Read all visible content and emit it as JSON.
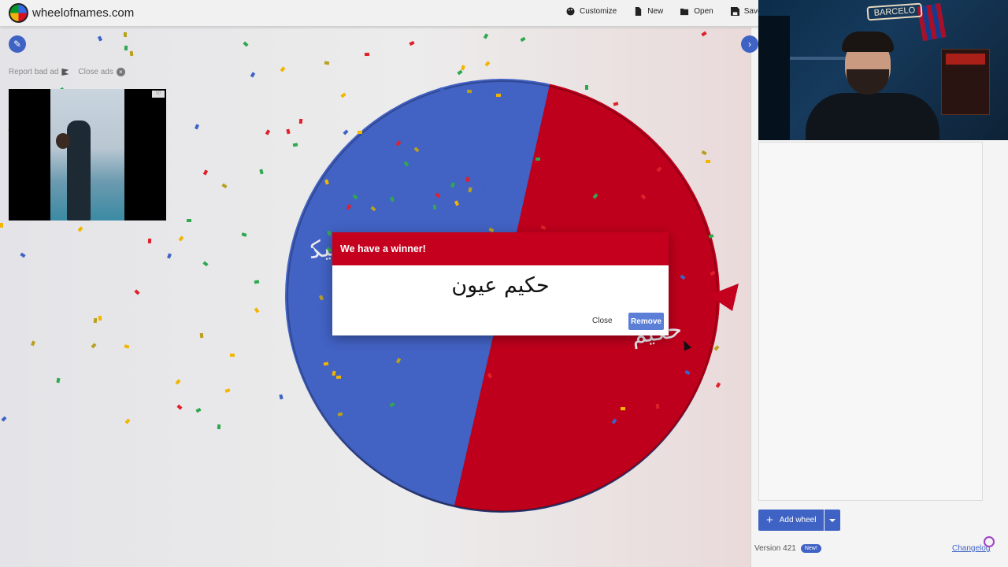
{
  "header": {
    "site_title": "wheelofnames.com",
    "toolbar": [
      {
        "label": "Customize",
        "icon": "palette-icon"
      },
      {
        "label": "New",
        "icon": "file-icon"
      },
      {
        "label": "Open",
        "icon": "folder-open-icon"
      },
      {
        "label": "Save",
        "icon": "save-icon"
      }
    ]
  },
  "ad": {
    "report_label": "Report bad ad",
    "close_label": "Close ads"
  },
  "wheel": {
    "segments": [
      {
        "color": "#4262c4",
        "label": "ﻢﻴﻜ"
      },
      {
        "color": "#bf001c",
        "label": "ﺣﻜﻴﻢ"
      }
    ]
  },
  "dialog": {
    "title": "We have a winner!",
    "winner": "حكيم عيون",
    "close_label": "Close",
    "remove_label": "Remove",
    "header_color": "#c4001e"
  },
  "sidebar": {
    "add_wheel_label": "Add wheel",
    "version_label": "Version 421",
    "new_badge": "New!",
    "changelog_label": "Changelog"
  },
  "colors": {
    "accent": "#3f63c4",
    "wheel_blue": "#4262c4",
    "wheel_red": "#bf001c"
  }
}
